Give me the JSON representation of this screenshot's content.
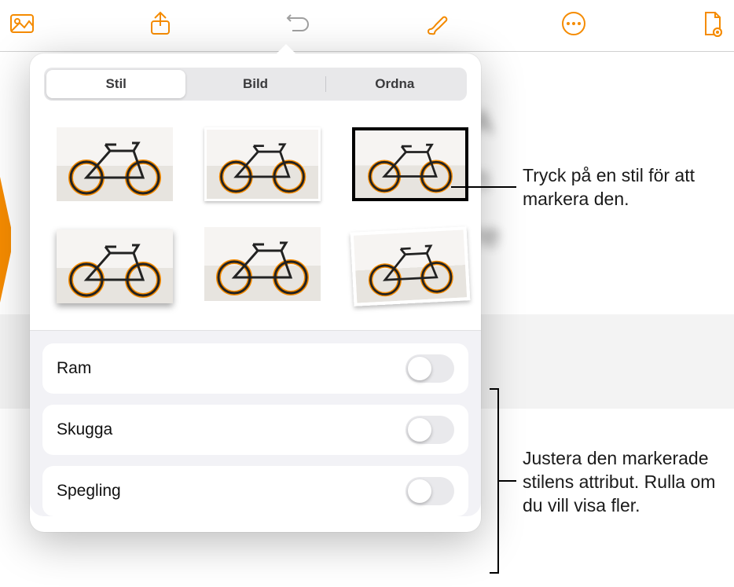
{
  "toolbar": {
    "icons": [
      "photo-icon",
      "share-icon",
      "undo-icon",
      "brush-icon",
      "more-icon",
      "document-icon"
    ]
  },
  "popover": {
    "tabs": [
      {
        "label": "Stil",
        "active": true
      },
      {
        "label": "Bild",
        "active": false
      },
      {
        "label": "Ordna",
        "active": false
      }
    ],
    "settings": [
      {
        "label": "Ram",
        "on": false
      },
      {
        "label": "Skugga",
        "on": false
      },
      {
        "label": "Spegling",
        "on": false
      }
    ]
  },
  "callouts": {
    "style": "Tryck på en stil för att markera den.",
    "attrs": "Justera den markerade stilens attribut. Rulla om du vill visa fler."
  }
}
